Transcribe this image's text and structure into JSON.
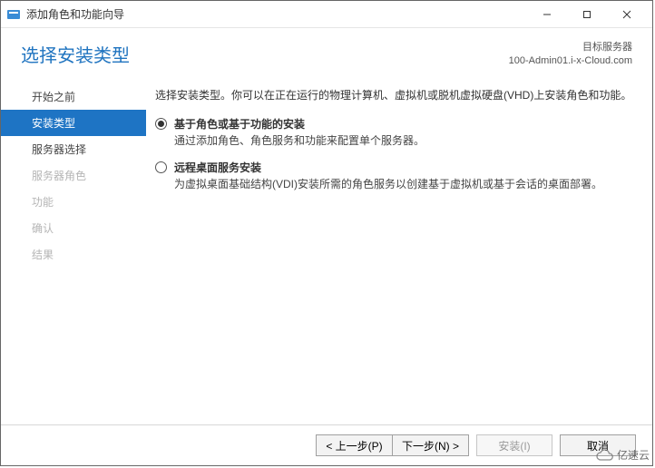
{
  "window": {
    "title": "添加角色和功能向导"
  },
  "header": {
    "title": "选择安装类型",
    "target_label": "目标服务器",
    "target_server": "100-Admin01.i-x-Cloud.com"
  },
  "sidebar": {
    "items": [
      {
        "label": "开始之前",
        "state": "normal"
      },
      {
        "label": "安装类型",
        "state": "active"
      },
      {
        "label": "服务器选择",
        "state": "normal"
      },
      {
        "label": "服务器角色",
        "state": "disabled"
      },
      {
        "label": "功能",
        "state": "disabled"
      },
      {
        "label": "确认",
        "state": "disabled"
      },
      {
        "label": "结果",
        "state": "disabled"
      }
    ]
  },
  "main": {
    "intro": "选择安装类型。你可以在正在运行的物理计算机、虚拟机或脱机虚拟硬盘(VHD)上安装角色和功能。",
    "options": [
      {
        "title": "基于角色或基于功能的安装",
        "desc": "通过添加角色、角色服务和功能来配置单个服务器。",
        "checked": true
      },
      {
        "title": "远程桌面服务安装",
        "desc": "为虚拟桌面基础结构(VDI)安装所需的角色服务以创建基于虚拟机或基于会话的桌面部署。",
        "checked": false
      }
    ]
  },
  "footer": {
    "prev": "< 上一步(P)",
    "next": "下一步(N) >",
    "install": "安装(I)",
    "cancel": "取消"
  },
  "watermark": "亿速云"
}
